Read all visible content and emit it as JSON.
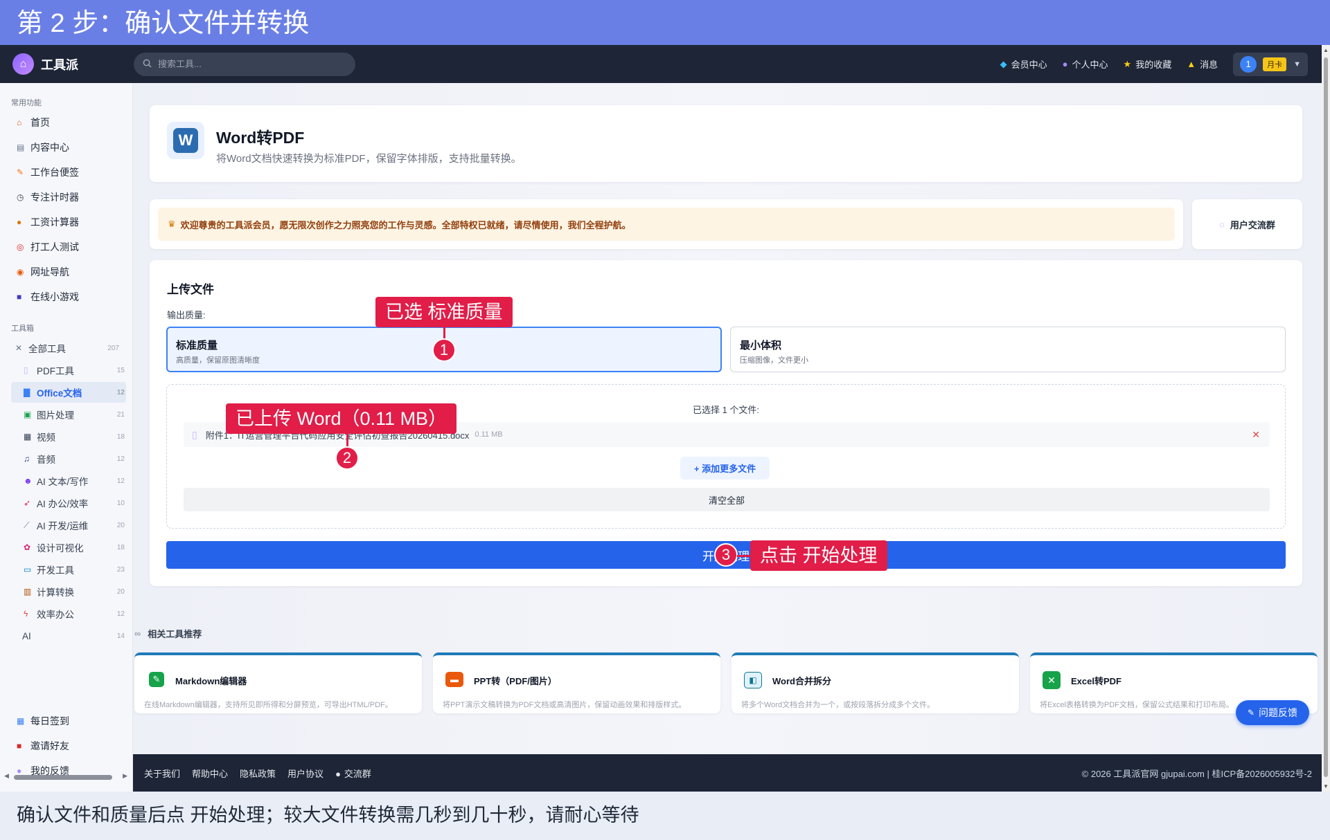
{
  "banner": {
    "title": "第 2 步：确认文件并转换"
  },
  "caption": {
    "text": "确认文件和质量后点 开始处理；较大文件转换需几秒到几十秒，请耐心等待"
  },
  "topbar": {
    "logo": "工具派",
    "search_placeholder": "搜索工具...",
    "links": [
      "会员中心",
      "个人中心",
      "我的收藏",
      "消息"
    ],
    "avatar": "1",
    "vip_badge": "月卡"
  },
  "sidebar": {
    "section_common": "常用功能",
    "common": [
      "首页",
      "内容中心",
      "工作台便签",
      "专注计时器",
      "工资计算器",
      "打工人测试",
      "网址导航",
      "在线小游戏"
    ],
    "section_tools": "工具箱",
    "all_tools": {
      "label": "全部工具",
      "count": "207"
    },
    "categories": [
      {
        "label": "PDF工具",
        "count": "15"
      },
      {
        "label": "Office文档",
        "count": "12"
      },
      {
        "label": "图片处理",
        "count": "21"
      },
      {
        "label": "视频",
        "count": "18"
      },
      {
        "label": "音频",
        "count": "12"
      },
      {
        "label": "AI 文本/写作",
        "count": "12"
      },
      {
        "label": "AI 办公/效率",
        "count": "10"
      },
      {
        "label": "AI 开发/运维",
        "count": "20"
      },
      {
        "label": "设计可视化",
        "count": "18"
      },
      {
        "label": "开发工具",
        "count": "23"
      },
      {
        "label": "计算转换",
        "count": "20"
      },
      {
        "label": "效率办公",
        "count": "12"
      },
      {
        "label": "AI",
        "count": "14"
      }
    ],
    "bottom": [
      "每日签到",
      "邀请好友",
      "我的反馈"
    ]
  },
  "tool": {
    "icon_letter": "W",
    "title": "Word转PDF",
    "desc": "将Word文档快速转换为标准PDF，保留字体排版，支持批量转换。"
  },
  "notice": {
    "text": "欢迎尊贵的工具派会员，愿无限次创作之力照亮您的工作与灵感。全部特权已就绪，请尽情使用，我们全程护航。",
    "group_btn": "用户交流群"
  },
  "upload": {
    "title": "上传文件",
    "quality_label": "输出质量:",
    "options": [
      {
        "name": "标准质量",
        "desc": "高质量，保留原图清晰度"
      },
      {
        "name": "最小体积",
        "desc": "压缩图像，文件更小"
      }
    ],
    "selected_count": "已选择 1 个文件:",
    "file_name": "附件1：IT运营管理平台代码应用安全评估初查报告20260415.docx",
    "file_size": "0.11 MB",
    "add_more": "+ 添加更多文件",
    "clear_all": "清空全部",
    "start": "开始处理"
  },
  "related": {
    "title": "相关工具推荐",
    "items": [
      {
        "name": "Markdown编辑器",
        "desc": "在线Markdown编辑器，支持所见即所得和分屏预览，可导出HTML/PDF。",
        "color": "#16a34a"
      },
      {
        "name": "PPT转（PDF/图片）",
        "desc": "将PPT演示文稿转换为PDF文档或高清图片，保留动画效果和排版样式。",
        "color": "#ea580c"
      },
      {
        "name": "Word合并拆分",
        "desc": "将多个Word文档合并为一个，或按段落拆分成多个文件。",
        "color": "#0e7490"
      },
      {
        "name": "Excel转PDF",
        "desc": "将Excel表格转换为PDF文档，保留公式结果和打印布局。",
        "color": "#16a34a"
      }
    ]
  },
  "feedback_btn": "问题反馈",
  "footer": {
    "links": [
      "关于我们",
      "帮助中心",
      "隐私政策",
      "用户协议",
      "交流群"
    ],
    "copyright": "© 2026 工具派官网 gjupai.com | 桂ICP备2026005932号-2"
  },
  "callouts": {
    "c1": {
      "num": "1",
      "text": "已选 标准质量"
    },
    "c2": {
      "num": "2",
      "text": "已上传 Word（0.11 MB）"
    },
    "c3": {
      "num": "3",
      "text": "点击 开始处理"
    }
  },
  "colors": {
    "primary": "#2563eb",
    "callout": "#e11d48",
    "banner": "#6a7fe6",
    "topbar": "#1d2537"
  }
}
